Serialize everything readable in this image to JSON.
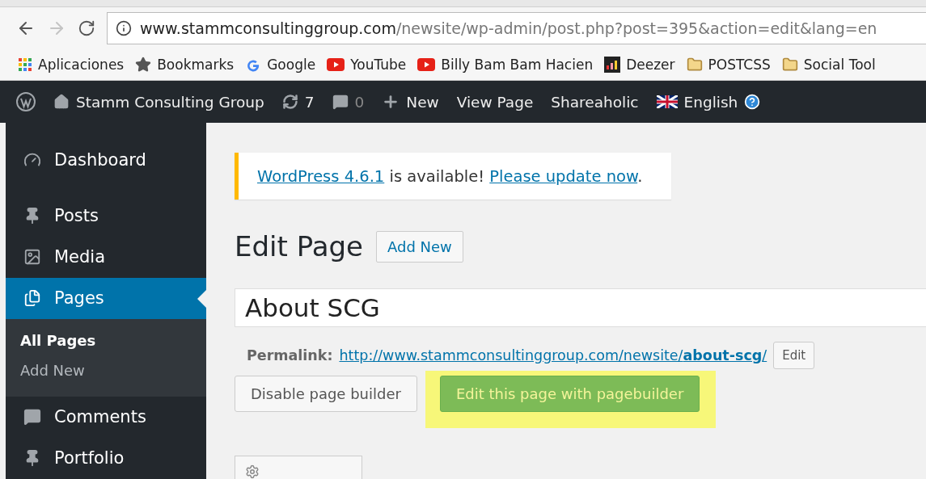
{
  "browser": {
    "address": {
      "host": "www.stammconsultinggroup.com",
      "path": "/newsite/wp-admin/post.php?post=395&action=edit&lang=en"
    },
    "bookmarks": [
      {
        "kind": "apps",
        "label": "Aplicaciones"
      },
      {
        "kind": "star",
        "label": "Bookmarks"
      },
      {
        "kind": "google",
        "label": "Google"
      },
      {
        "kind": "youtube",
        "label": "YouTube"
      },
      {
        "kind": "youtube",
        "label": "Billy Bam Bam Hacien"
      },
      {
        "kind": "deezer",
        "label": "Deezer"
      },
      {
        "kind": "folder",
        "label": "POSTCSS"
      },
      {
        "kind": "folder",
        "label": "Social Tool"
      }
    ]
  },
  "admin_bar": {
    "site": "Stamm Consulting Group",
    "updates": "7",
    "comments": "0",
    "new": "New",
    "links": [
      "View Page",
      "Shareaholic"
    ],
    "language": "English"
  },
  "sidebar": {
    "items": [
      {
        "kind": "dashboard",
        "label": "Dashboard",
        "selected": false
      },
      {
        "kind": "posts",
        "label": "Posts",
        "selected": false
      },
      {
        "kind": "media",
        "label": "Media",
        "selected": false
      },
      {
        "kind": "pages",
        "label": "Pages",
        "selected": true,
        "children": [
          {
            "label": "All Pages",
            "selected": true
          },
          {
            "label": "Add New",
            "selected": false
          }
        ]
      },
      {
        "kind": "comments",
        "label": "Comments",
        "selected": false
      },
      {
        "kind": "posts",
        "label": "Portfolio",
        "selected": false
      }
    ]
  },
  "notice": {
    "version_link": "WordPress 4.6.1",
    "message": "is available!",
    "update_link": "Please update now",
    "end": "."
  },
  "page": {
    "heading": "Edit Page",
    "add_new": "Add New",
    "title_value": "About SCG",
    "permalink": {
      "label": "Permalink:",
      "url": "http://www.stammconsultinggroup.com/newsite/**about-scg**/",
      "edit": "Edit"
    },
    "buttons": [
      {
        "label": "Disable page builder",
        "kind": "secondary",
        "highlighted": false
      },
      {
        "label": "Edit this page with pagebuilder",
        "kind": "primary",
        "highlighted": true
      }
    ]
  }
}
